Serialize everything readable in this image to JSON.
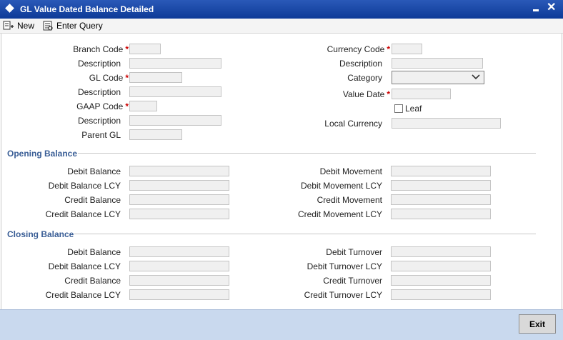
{
  "window": {
    "title": "GL Value Dated Balance Detailed"
  },
  "toolbar": {
    "new_label": "New",
    "enter_query_label": "Enter Query"
  },
  "header_left": {
    "branch_code": "Branch Code",
    "description_1": "Description",
    "gl_code": "GL Code",
    "description_2": "Description",
    "gaap_code": "GAAP Code",
    "description_3": "Description",
    "parent_gl": "Parent GL"
  },
  "header_right": {
    "currency_code": "Currency Code",
    "description": "Description",
    "category": "Category",
    "value_date": "Value Date",
    "leaf": "Leaf",
    "local_currency": "Local Currency"
  },
  "required_marker": "*",
  "opening": {
    "title": "Opening Balance",
    "left": [
      "Debit Balance",
      "Debit Balance LCY",
      "Credit Balance",
      "Credit Balance LCY"
    ],
    "right": [
      "Debit Movement",
      "Debit Movement LCY",
      "Credit Movement",
      "Credit Movement LCY"
    ]
  },
  "closing": {
    "title": "Closing Balance",
    "left": [
      "Debit Balance",
      "Debit Balance LCY",
      "Credit Balance",
      "Credit Balance LCY"
    ],
    "right": [
      "Debit Turnover",
      "Debit Turnover LCY",
      "Credit Turnover",
      "Credit Turnover LCY"
    ]
  },
  "footer": {
    "exit_label": "Exit"
  },
  "colors": {
    "titlebar": "#0d3a97",
    "section_title": "#3a5e96",
    "footer": "#c9d9ee",
    "required": "#cc0000"
  }
}
